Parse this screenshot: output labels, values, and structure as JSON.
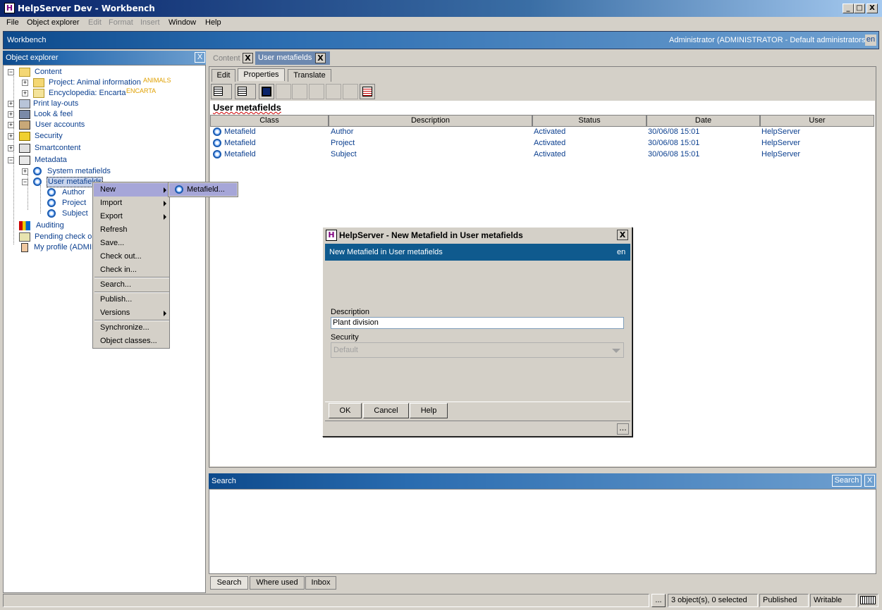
{
  "window": {
    "title": "HelpServer Dev - Workbench",
    "min": "_",
    "max": "□",
    "close": "X"
  },
  "menu": {
    "file": "File",
    "object_explorer": "Object explorer",
    "edit": "Edit",
    "format": "Format",
    "insert": "Insert",
    "window": "Window",
    "help": "Help"
  },
  "workbench": {
    "title": "Workbench",
    "user": "Administrator (ADMINISTRATOR - Default administrators)",
    "lang": "en"
  },
  "explorer": {
    "title": "Object explorer",
    "close": "X",
    "tree": [
      {
        "label": "Content"
      },
      {
        "label": "Project: Animal information",
        "tag": "ANIMALS"
      },
      {
        "label": "Encyclopedia: Encarta",
        "tag": "ENCARTA"
      },
      {
        "label": "Print lay-outs"
      },
      {
        "label": "Look & feel"
      },
      {
        "label": "User accounts"
      },
      {
        "label": "Security"
      },
      {
        "label": "Smartcontent"
      },
      {
        "label": "Metadata"
      },
      {
        "label": "System metafields"
      },
      {
        "label": "User metafields"
      },
      {
        "label": "Author"
      },
      {
        "label": "Project"
      },
      {
        "label": "Subject"
      },
      {
        "label": "Auditing"
      },
      {
        "label": "Pending check ou"
      },
      {
        "label": "My profile (ADMIN"
      }
    ]
  },
  "doc_tabs": {
    "content": "Content",
    "content_close": "X",
    "user_metafields": "User metafields",
    "um_close": "X"
  },
  "sub_tabs": {
    "edit": "Edit",
    "properties": "Properties",
    "translate": "Translate"
  },
  "grid": {
    "title": "User metafields",
    "columns": [
      "Class",
      "Description",
      "Status",
      "Date",
      "User"
    ],
    "rows": [
      [
        "Metafield",
        "Author",
        "Activated",
        "30/06/08 15:01",
        "HelpServer"
      ],
      [
        "Metafield",
        "Project",
        "Activated",
        "30/06/08 15:01",
        "HelpServer"
      ],
      [
        "Metafield",
        "Subject",
        "Activated",
        "30/06/08 15:01",
        "HelpServer"
      ]
    ]
  },
  "context_menu": {
    "items": [
      "New",
      "Import",
      "Export",
      "Refresh",
      "Save...",
      "Check out...",
      "Check in...",
      "Search...",
      "Publish...",
      "Versions",
      "Synchronize...",
      "Object classes..."
    ],
    "submenu": "Metafield..."
  },
  "dialog": {
    "title": "HelpServer - New Metafield in User metafields",
    "header": "New Metafield in User metafields",
    "lang": "en",
    "description_label": "Description",
    "description_value": "Plant division",
    "security_label": "Security",
    "security_value": "Default",
    "ok": "OK",
    "cancel": "Cancel",
    "help": "Help",
    "more": "...",
    "close": "X"
  },
  "search_panel": {
    "title": "Search",
    "button": "Search",
    "close": "X"
  },
  "bottom_tabs": {
    "search": "Search",
    "where_used": "Where used",
    "inbox": "Inbox"
  },
  "statusbar": {
    "more": "...",
    "count": "3 object(s), 0 selected",
    "published": "Published",
    "writable": "Writable"
  }
}
